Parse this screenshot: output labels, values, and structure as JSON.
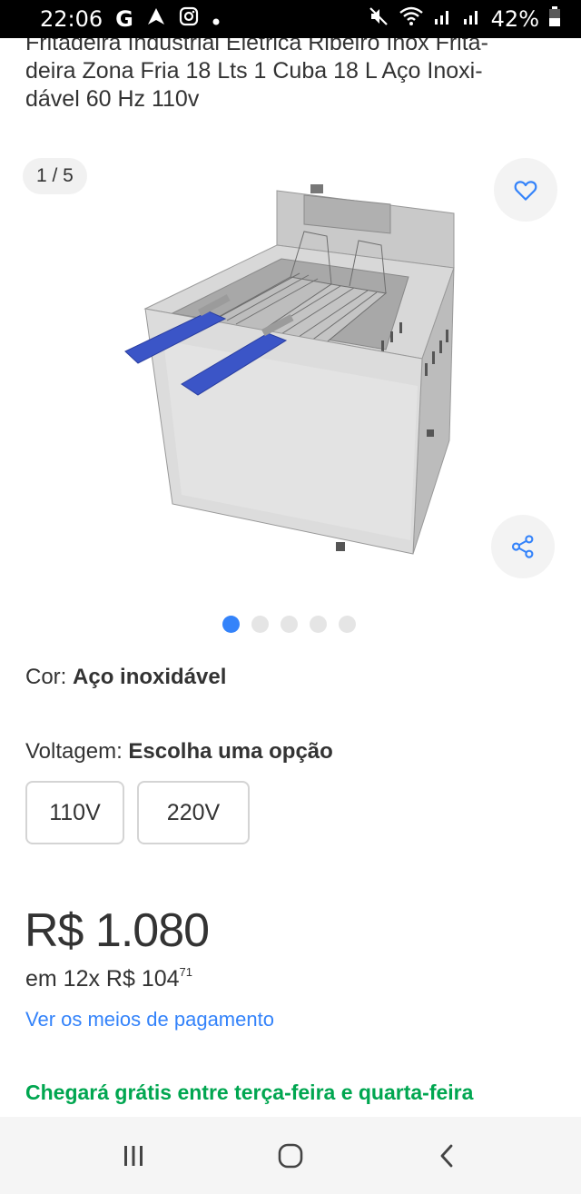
{
  "status_bar": {
    "time": "22:06",
    "left_icons": [
      "google-g-icon",
      "navigation-arrow-icon",
      "instagram-icon",
      "notification-dot-icon"
    ],
    "battery": "42%",
    "right_icons": [
      "mute-icon",
      "wifi-icon",
      "signal-icon",
      "signal-icon",
      "battery-icon"
    ]
  },
  "product": {
    "title": "Fritadeira Industrial Elétrica Ribeiro Inox Fritadeira Zona Fria 18 Lts 1 Cuba 18 L Aço Inoxidável 60 Hz 110v",
    "title_line2": "deira Zona Fria 18 Lts 1 Cuba 18 L Aço Inoxi-",
    "title_line3": "dável 60 Hz 110v",
    "title_line1_partial": "Fritadeira Industrial Elétrica Ribeiro Inox Frita-"
  },
  "gallery": {
    "counter": "1 / 5",
    "current_index": 1,
    "total": 5,
    "image_alt": "fryer-product-image"
  },
  "variations": {
    "color_label": "Cor: ",
    "color_value": "Aço inoxidável",
    "voltage_label": "Voltagem: ",
    "voltage_value": "Escolha uma opção",
    "voltage_options": [
      "110V",
      "220V"
    ]
  },
  "pricing": {
    "price": "R$ 1.080",
    "installments_prefix": "em 12x R$ 104",
    "installments_cents": "71",
    "payment_link": "Ver os meios de pagamento"
  },
  "shipping": {
    "text": "Chegará grátis entre terça-feira e quarta-feira"
  },
  "colors": {
    "accent_blue": "#3483fa",
    "shipping_green": "#00a650"
  }
}
